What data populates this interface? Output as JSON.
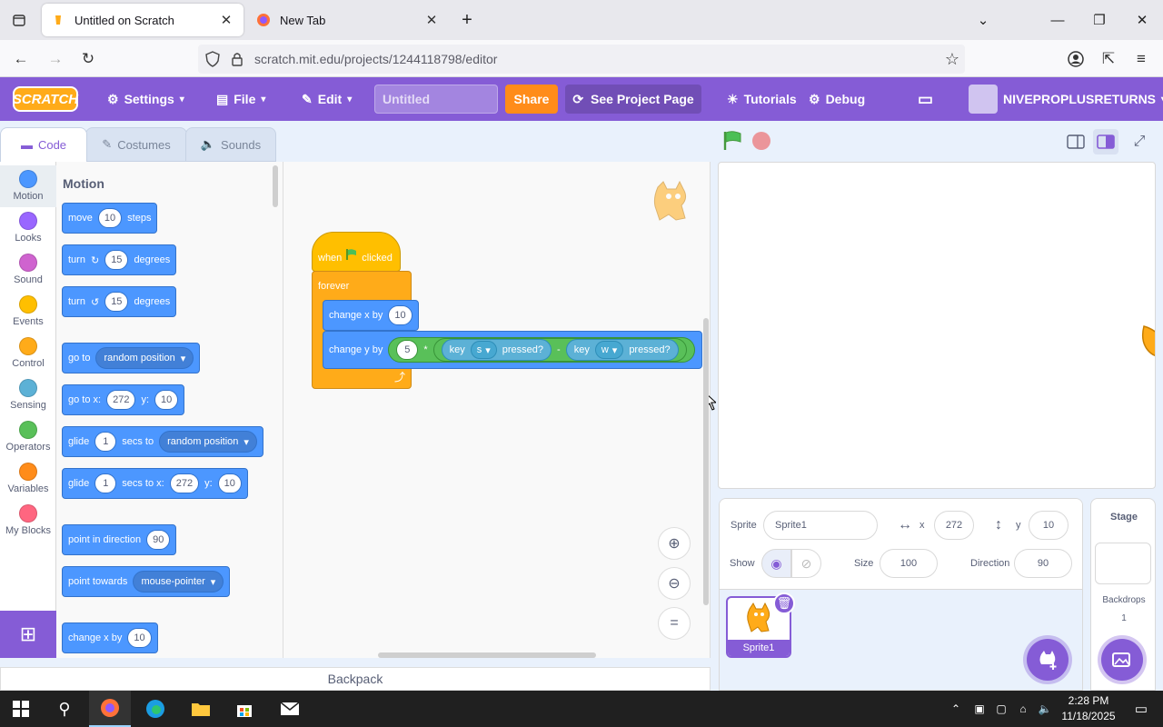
{
  "browser": {
    "tabs": [
      {
        "title": "Untitled on Scratch",
        "active": true
      },
      {
        "title": "New Tab",
        "active": false
      }
    ],
    "url": "scratch.mit.edu/projects/1244118798/editor"
  },
  "menu": {
    "logo": "SCRATCH",
    "settings": "Settings",
    "file": "File",
    "edit": "Edit",
    "project_title_placeholder": "Untitled",
    "share": "Share",
    "see_project_page": "See Project Page",
    "tutorials": "Tutorials",
    "debug": "Debug",
    "username": "NIVEPROPLUSRETURNS"
  },
  "editor_tabs": {
    "code": "Code",
    "costumes": "Costumes",
    "sounds": "Sounds"
  },
  "categories": [
    {
      "label": "Motion",
      "color": "#4c97ff"
    },
    {
      "label": "Looks",
      "color": "#9966ff"
    },
    {
      "label": "Sound",
      "color": "#cf63cf"
    },
    {
      "label": "Events",
      "color": "#ffbf00"
    },
    {
      "label": "Control",
      "color": "#ffab19"
    },
    {
      "label": "Sensing",
      "color": "#5cb1d6"
    },
    {
      "label": "Operators",
      "color": "#59c059"
    },
    {
      "label": "Variables",
      "color": "#ff8c1a"
    },
    {
      "label": "My Blocks",
      "color": "#ff6680"
    }
  ],
  "palette": {
    "heading": "Motion",
    "move": {
      "a": "move",
      "v": "10",
      "b": "steps"
    },
    "turn_right": {
      "a": "turn",
      "v": "15",
      "b": "degrees"
    },
    "turn_left": {
      "a": "turn",
      "v": "15",
      "b": "degrees"
    },
    "goto": {
      "a": "go to",
      "d": "random position"
    },
    "gotoxy": {
      "a": "go to x:",
      "x": "272",
      "b": "y:",
      "y": "10"
    },
    "glide_to": {
      "a": "glide",
      "v": "1",
      "b": "secs to",
      "d": "random position"
    },
    "glide_xy": {
      "a": "glide",
      "v": "1",
      "b": "secs to x:",
      "x": "272",
      "c": "y:",
      "y": "10"
    },
    "point_dir": {
      "a": "point in direction",
      "v": "90"
    },
    "point_towards": {
      "a": "point towards",
      "d": "mouse-pointer"
    },
    "change_x": {
      "a": "change x by",
      "v": "10"
    }
  },
  "script": {
    "hat": {
      "a": "when",
      "b": "clicked"
    },
    "forever": "forever",
    "change_x": {
      "a": "change x by",
      "v": "10"
    },
    "change_y": {
      "a": "change y by",
      "mult_left": "5",
      "op_mult": "*",
      "op_minus": "-",
      "key1": {
        "a": "key",
        "k": "s",
        "b": "pressed?"
      },
      "key2": {
        "a": "key",
        "k": "w",
        "b": "pressed?"
      }
    }
  },
  "backpack": "Backpack",
  "sprite_info": {
    "sprite_label": "Sprite",
    "sprite_name": "Sprite1",
    "x_label": "x",
    "x": "272",
    "y_label": "y",
    "y": "10",
    "show_label": "Show",
    "size_label": "Size",
    "size": "100",
    "direction_label": "Direction",
    "direction": "90"
  },
  "sprites": [
    {
      "name": "Sprite1"
    }
  ],
  "stage_panel": {
    "title": "Stage",
    "backdrops_label": "Backdrops",
    "backdrops_count": "1"
  },
  "taskbar": {
    "time": "2:28 PM",
    "date": "11/18/2025"
  },
  "colors": {
    "scratch_purple": "#855cd6",
    "motion_blue": "#4c97ff",
    "share_orange": "#ff8c1a"
  }
}
